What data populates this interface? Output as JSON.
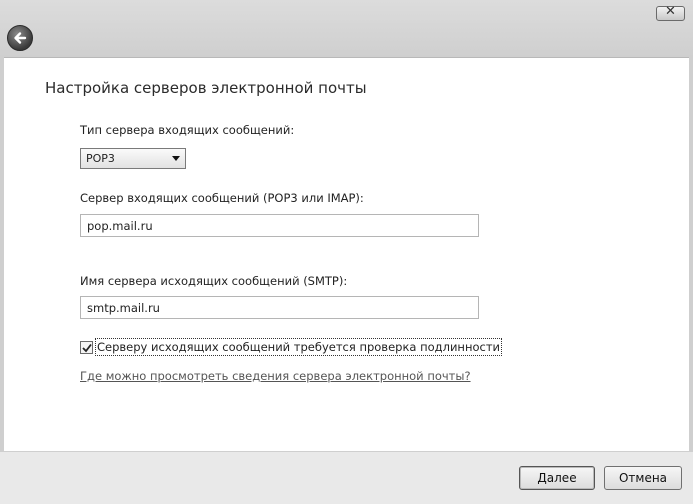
{
  "window": {
    "close_label": "✕"
  },
  "page_title": "Настройка серверов электронной почты",
  "incoming_type": {
    "label": "Тип сервера входящих сообщений:",
    "value": "POP3"
  },
  "incoming_server": {
    "label": "Сервер входящих сообщений (POP3 или IMAP):",
    "value": "pop.mail.ru"
  },
  "outgoing_server": {
    "label": "Имя сервера исходящих сообщений (SMTP):",
    "value": "smtp.mail.ru"
  },
  "auth_checkbox": {
    "label": "Серверу исходящих сообщений требуется проверка подлинности",
    "checked": true
  },
  "help_link": "Где можно просмотреть сведения сервера электронной почты?",
  "buttons": {
    "next": "Далее",
    "cancel": "Отмена"
  },
  "icons": {
    "back": "back-arrow-icon",
    "close": "close-icon",
    "dropdown": "chevron-down-icon",
    "check": "checkmark-icon"
  }
}
